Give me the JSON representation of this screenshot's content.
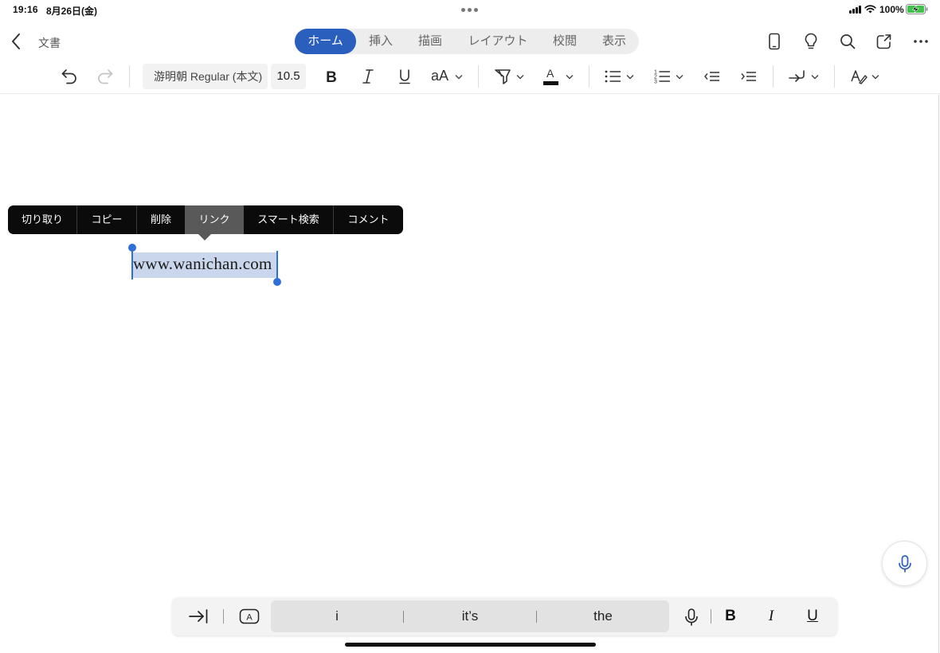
{
  "status_bar": {
    "time": "19:16",
    "date": "8月26日(金)",
    "battery": "100%"
  },
  "header": {
    "document_title": "文書",
    "tabs": [
      {
        "label": "ホーム",
        "active": true
      },
      {
        "label": "挿入",
        "active": false
      },
      {
        "label": "描画",
        "active": false
      },
      {
        "label": "レイアウト",
        "active": false
      },
      {
        "label": "校閲",
        "active": false
      },
      {
        "label": "表示",
        "active": false
      }
    ],
    "right_icons": [
      "phone-view-icon",
      "lightbulb-icon",
      "search-icon",
      "share-icon",
      "more-icon"
    ]
  },
  "ribbon": {
    "font_name": "游明朝 Regular (本文)",
    "font_size": "10.5",
    "text_style_label": "aA",
    "font_color_letter": "A",
    "icons": [
      "undo-icon",
      "redo-icon",
      "bold-icon",
      "italic-icon",
      "underline-icon",
      "text-size-icon",
      "highlighter-icon",
      "font-color-icon",
      "bullets-icon",
      "numbering-icon",
      "decrease-indent-icon",
      "increase-indent-icon",
      "paragraph-mark-icon",
      "styles-icon"
    ]
  },
  "context_menu": {
    "items": [
      {
        "label": "切り取り",
        "active": false
      },
      {
        "label": "コピー",
        "active": false
      },
      {
        "label": "削除",
        "active": false
      },
      {
        "label": "リンク",
        "active": true
      },
      {
        "label": "スマート検索",
        "active": false
      },
      {
        "label": "コメント",
        "active": false
      }
    ]
  },
  "document": {
    "selected_text": "www.wanichan.com"
  },
  "shortcut_bar": {
    "predictions": [
      "i",
      "it’s",
      "the"
    ],
    "format_buttons": [
      "B",
      "I",
      "U"
    ]
  },
  "colors": {
    "accent": "#2b5fbd",
    "selection": "#c9d6ec",
    "handle": "#2f6fd9",
    "menu_bg": "#0b0b0b",
    "menu_active": "#595959"
  }
}
